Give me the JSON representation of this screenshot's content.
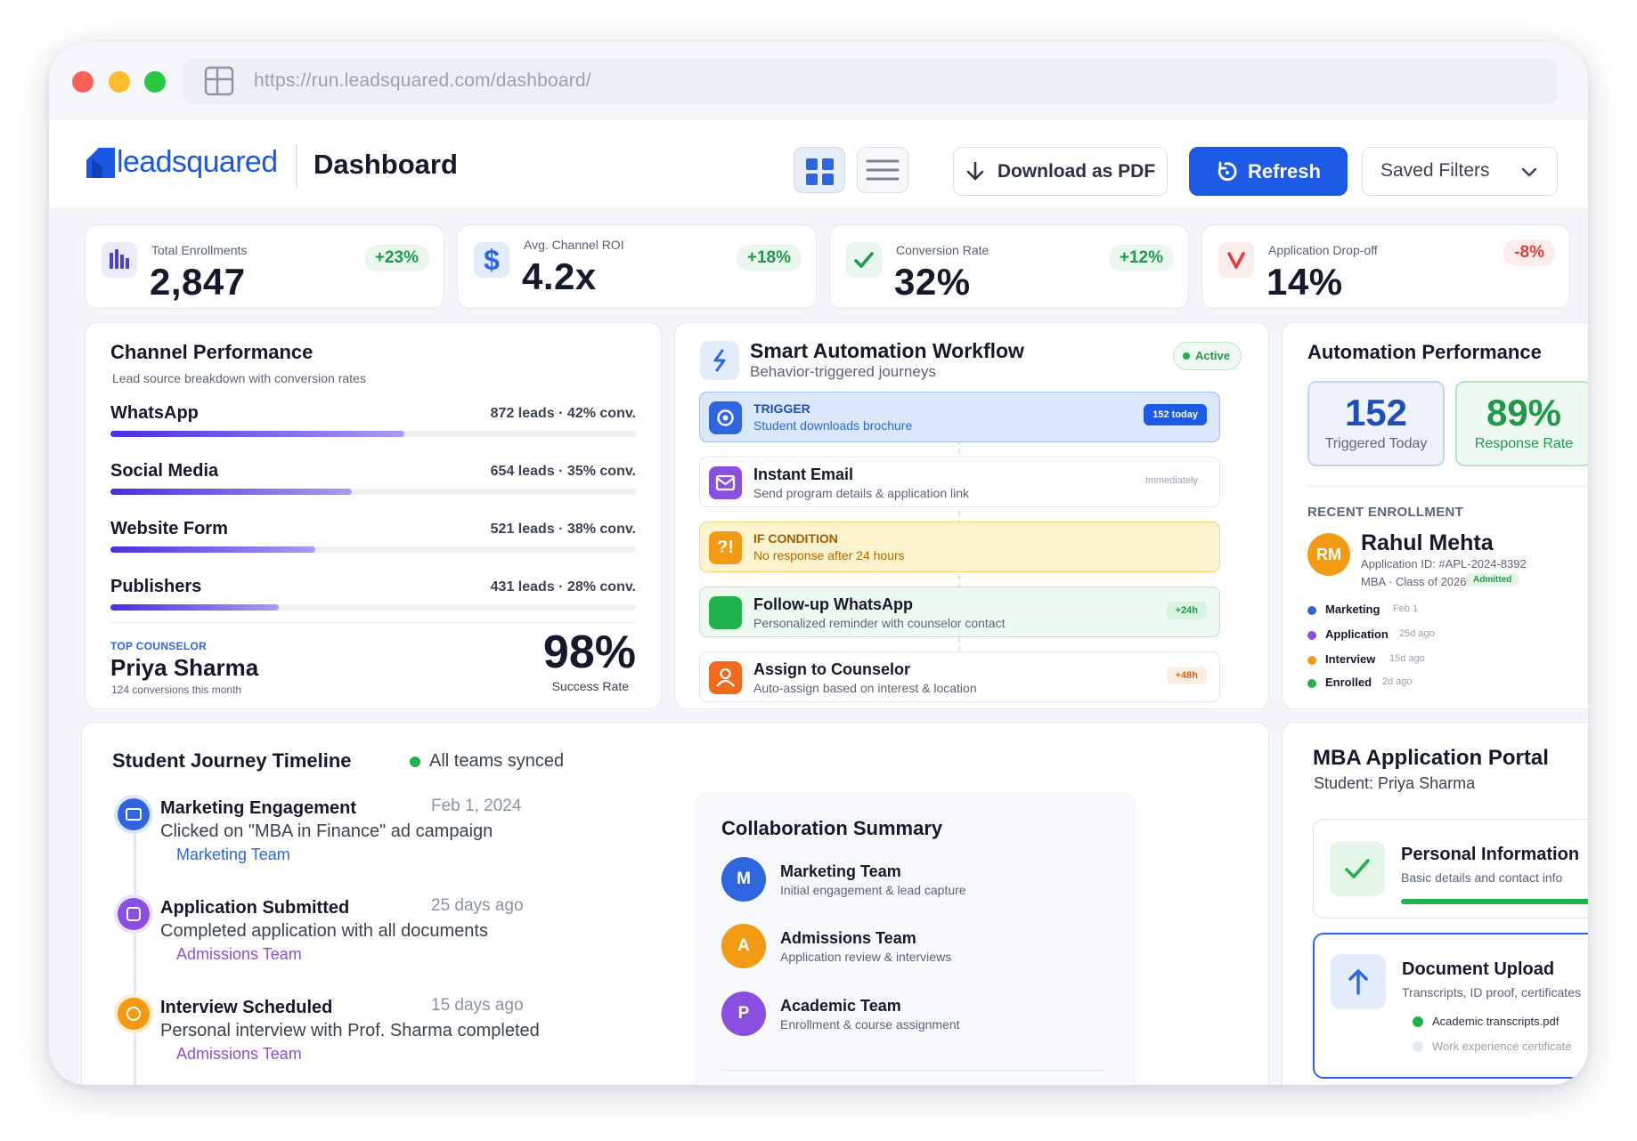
{
  "browser": {
    "url": "https://run.leadsquared.com/dashboard/"
  },
  "header": {
    "logo_text": "leadsquared",
    "page_title": "Dashboard",
    "download_label": "Download as PDF",
    "refresh_label": "Refresh",
    "saved_filters_label": "Saved Filters"
  },
  "kpis": [
    {
      "label": "Total Enrollments",
      "value": "2,847",
      "delta": "+23%",
      "icon": "bar-chart-icon",
      "color": "#4a3fd8"
    },
    {
      "label": "Avg. Channel ROI",
      "value": "4.2x",
      "delta": "+18%",
      "icon": "dollar-icon",
      "color": "#2f66e0"
    },
    {
      "label": "Conversion Rate",
      "value": "32%",
      "delta": "+12%",
      "icon": "check-icon",
      "color": "#1e9a4a"
    },
    {
      "label": "Application Drop-off",
      "value": "14%",
      "delta": "-8%",
      "icon": "down-arrow-icon",
      "color": "#e53c3c"
    }
  ],
  "channels": {
    "title": "Channel Performance",
    "subtitle": "Lead source breakdown with conversion rates",
    "rows": [
      {
        "name": "WhatsApp",
        "stats": "872 leads · 42% conv."
      },
      {
        "name": "Social Media",
        "stats": "654 leads · 35% conv."
      },
      {
        "name": "Website Form",
        "stats": "521 leads · 38% conv."
      },
      {
        "name": "Publishers",
        "stats": "431 leads · 28% conv."
      }
    ],
    "top_counselor_label": "TOP COUNSELOR",
    "top_counselor_name": "Priya Sharma",
    "top_counselor_sub": "124 conversions this month",
    "success_rate": "98%",
    "success_rate_label": "Success Rate"
  },
  "workflow": {
    "title": "Smart Automation Workflow",
    "subtitle": "Behavior-triggered journeys",
    "status": "Active",
    "steps": [
      {
        "title": "TRIGGER",
        "subtitle": "Student downloads brochure",
        "tag": "152 today"
      },
      {
        "title": "Instant Email",
        "subtitle": "Send program details & application link",
        "tag": "Immediately"
      },
      {
        "title": "IF CONDITION",
        "subtitle": "No response after 24 hours",
        "icon_text": "?!"
      },
      {
        "title": "Follow-up WhatsApp",
        "subtitle": "Personalized reminder with counselor contact",
        "tag": "+24h"
      },
      {
        "title": "Assign to Counselor",
        "subtitle": "Auto-assign based on interest & location",
        "tag": "+48h"
      }
    ]
  },
  "automation_perf": {
    "title": "Automation Performance",
    "triggered_value": "152",
    "triggered_label": "Triggered Today",
    "response_value": "89%",
    "response_label": "Response Rate",
    "recent_label": "RECENT ENROLLMENT",
    "avatar_initials": "RM",
    "student_name": "Rahul Mehta",
    "application_id": "Application ID: #APL-2024-8392",
    "program": "MBA · Class of 2026",
    "status_badge": "Admitted",
    "events": [
      {
        "name": "Marketing",
        "time": "Feb 1",
        "color": "#2f66e0"
      },
      {
        "name": "Application",
        "time": "25d ago",
        "color": "#8a4fe0"
      },
      {
        "name": "Interview",
        "time": "15d ago",
        "color": "#f29a12"
      },
      {
        "name": "Enrolled",
        "time": "2d ago",
        "color": "#22b24c"
      }
    ]
  },
  "journey": {
    "title": "Student Journey Timeline",
    "sync_status": "All teams synced",
    "items": [
      {
        "title": "Marketing Engagement",
        "date": "Feb 1, 2024",
        "desc": "Clicked on \"MBA in Finance\" ad campaign",
        "team": "Marketing Team",
        "color": "#2f66e0"
      },
      {
        "title": "Application Submitted",
        "date": "25 days ago",
        "desc": "Completed application with all documents",
        "team": "Admissions Team",
        "color": "#8a4fe0"
      },
      {
        "title": "Interview Scheduled",
        "date": "15 days ago",
        "desc": "Personal interview with Prof. Sharma completed",
        "team": "Admissions Team",
        "color": "#f29a12"
      }
    ]
  },
  "collaboration": {
    "title": "Collaboration Summary",
    "teams": [
      {
        "initial": "M",
        "name": "Marketing Team",
        "desc": "Initial engagement & lead capture",
        "color": "#2f66e0"
      },
      {
        "initial": "A",
        "name": "Admissions Team",
        "desc": "Application review & interviews",
        "color": "#f29a12"
      },
      {
        "initial": "P",
        "name": "Academic Team",
        "desc": "Enrollment & course assignment",
        "color": "#8a4fe0"
      }
    ]
  },
  "portal": {
    "title": "MBA Application Portal",
    "student": "Student: Priya Sharma",
    "personal_title": "Personal Information",
    "personal_sub": "Basic details and contact info",
    "personal_progress": 1.0,
    "doc_title": "Document Upload",
    "doc_sub": "Transcripts, ID proof, certificates",
    "docs": [
      {
        "name": "Academic transcripts.pdf",
        "done": true
      },
      {
        "name": "Work experience certificate",
        "done": false
      }
    ]
  }
}
